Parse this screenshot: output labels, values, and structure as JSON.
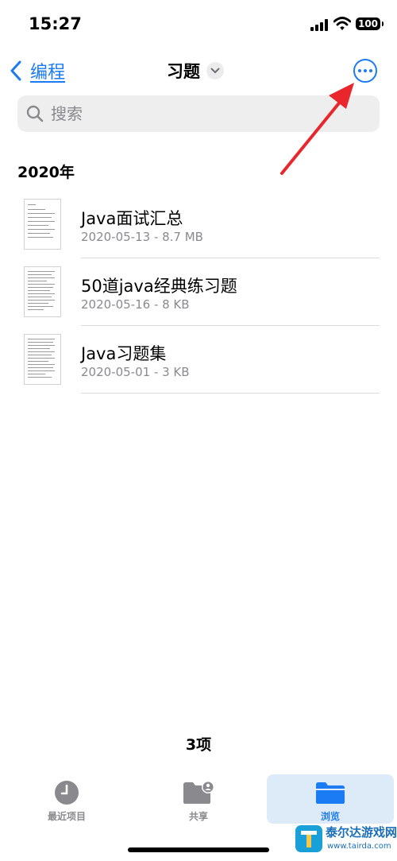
{
  "status_bar": {
    "time": "15:27",
    "battery": "100",
    "icons": [
      "signal-icon",
      "wifi-icon",
      "battery-icon"
    ]
  },
  "nav": {
    "back_label": "编程",
    "title": "习题",
    "icons": [
      "chevron-left-icon",
      "chevron-down-icon",
      "more-icon"
    ],
    "accent_color": "#1a7bf2"
  },
  "search": {
    "placeholder": "搜索"
  },
  "section": {
    "header": "2020年"
  },
  "files": [
    {
      "name": "Java面试汇总",
      "meta": "2020-05-13 - 8.7 MB"
    },
    {
      "name": "50道java经典练习题",
      "meta": "2020-05-16 - 8 KB"
    },
    {
      "name": "Java习题集",
      "meta": "2020-05-01 - 3 KB"
    }
  ],
  "footer": {
    "item_count": "3项"
  },
  "tabs": [
    {
      "label": "最近项目",
      "icon": "clock-icon",
      "selected": false
    },
    {
      "label": "共享",
      "icon": "shared-folder-icon",
      "selected": false
    },
    {
      "label": "浏览",
      "icon": "folder-icon",
      "selected": true
    }
  ],
  "watermark": {
    "text": "泰尔达游戏网",
    "url": "www.tairda.com"
  },
  "annotation": {
    "arrow_color": "#e8262b"
  }
}
